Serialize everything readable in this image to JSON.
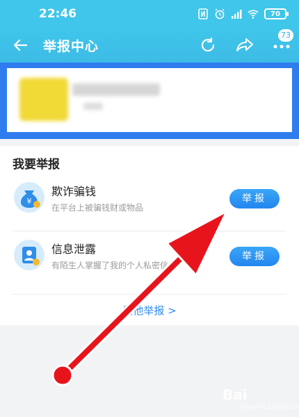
{
  "status_bar": {
    "time": "22:46",
    "battery": "70",
    "icons": [
      "nfc-icon",
      "alarm-icon",
      "signal-icon",
      "wifi-icon",
      "battery-icon"
    ]
  },
  "header": {
    "title": "举报中心",
    "badge_count": "73",
    "icons": [
      "back-arrow-icon",
      "refresh-icon",
      "share-icon",
      "more-icon"
    ]
  },
  "section": {
    "title": "我要举报",
    "items": [
      {
        "title": "欺诈骗钱",
        "desc": "在平台上被骗钱财或物品",
        "button": "举报",
        "icon": "money-bag-icon"
      },
      {
        "title": "信息泄露",
        "desc": "有陌生人掌握了我的个人私密信息",
        "button": "举报",
        "icon": "id-card-icon"
      }
    ],
    "other_link": "其他举报 >"
  },
  "watermark": {
    "text": "Bai",
    "sub": "jingyan.baidu.com"
  },
  "colors": {
    "header": "#3fc6ea",
    "highlight": "#2f7cef",
    "button": "#2286ef",
    "arrow": "#e8141c"
  }
}
